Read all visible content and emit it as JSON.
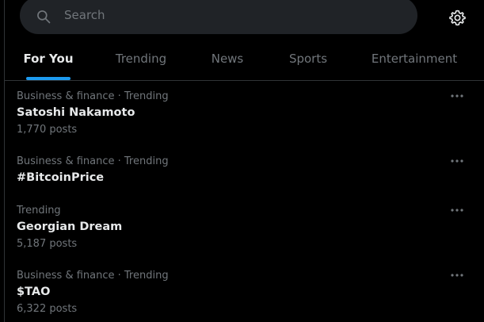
{
  "search": {
    "placeholder": "Search",
    "value": ""
  },
  "icons": {
    "search": "search-icon",
    "settings": "gear-icon",
    "more": "more-horizontal-icon"
  },
  "colors": {
    "background": "#000000",
    "search_bg": "#202327",
    "text_primary": "#e7e9ea",
    "text_secondary": "#71767b",
    "accent": "#1d9bf0",
    "divider": "#2f3336"
  },
  "tabs": [
    {
      "label": "For You",
      "active": true
    },
    {
      "label": "Trending",
      "active": false
    },
    {
      "label": "News",
      "active": false
    },
    {
      "label": "Sports",
      "active": false
    },
    {
      "label": "Entertainment",
      "active": false
    }
  ],
  "trends": [
    {
      "context": "Business & finance · Trending",
      "name": "Satoshi Nakamoto",
      "count": "1,770 posts"
    },
    {
      "context": "Business & finance · Trending",
      "name": "#BitcoinPrice",
      "count": ""
    },
    {
      "context": "Trending",
      "name": "Georgian Dream",
      "count": "5,187 posts"
    },
    {
      "context": "Business & finance · Trending",
      "name": "$TAO",
      "count": "6,322 posts"
    }
  ]
}
